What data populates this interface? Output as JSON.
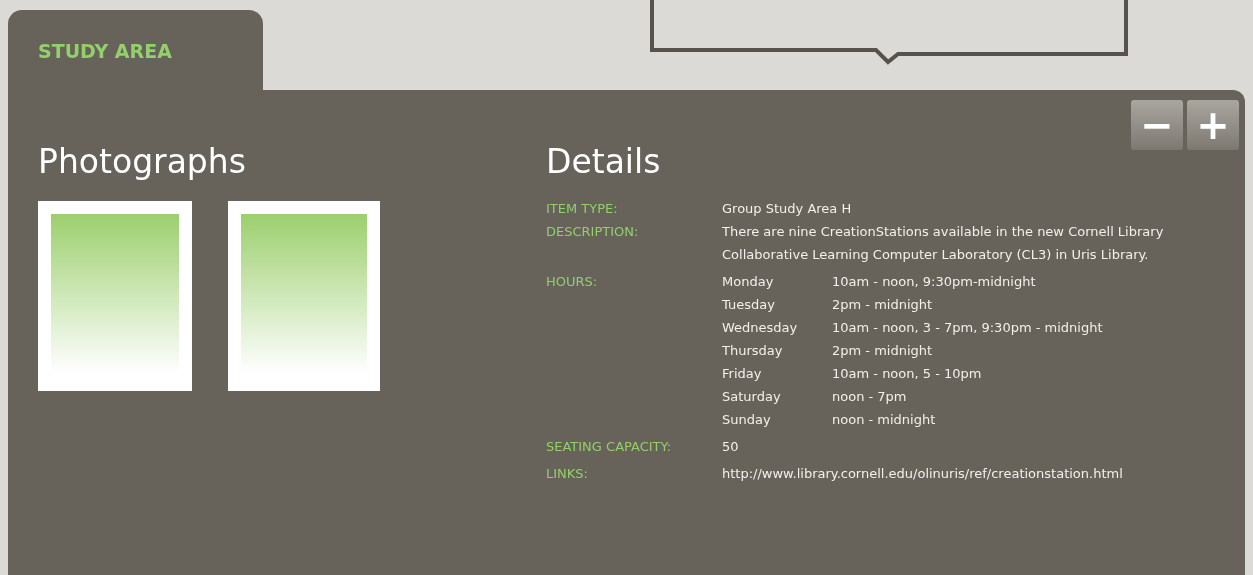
{
  "tab": {
    "label": "STUDY AREA",
    "selected": true
  },
  "zoom_buttons": [
    "−",
    "+"
  ],
  "photographs": {
    "title": "Photographs"
  },
  "details": {
    "title": "Details",
    "fields": [
      {
        "kind": "text",
        "label": "ITEM TYPE:",
        "value": "Group Study Area H"
      },
      {
        "kind": "text",
        "label": "DESCRIPTION:",
        "value": "There are nine CreationStations available in the new Cornell Library Collaborative Learning Computer Laboratory (CL3) in Uris Library."
      },
      {
        "kind": "hours",
        "label": "HOURS:",
        "rows": [
          {
            "day": "Monday",
            "time": "10am - noon, 9:30pm-midnight"
          },
          {
            "day": "Tuesday",
            "time": "2pm - midnight"
          },
          {
            "day": "Wednesday",
            "time": "10am - noon, 3 - 7pm, 9:30pm - midnight"
          },
          {
            "day": "Thursday",
            "time": "2pm - midnight"
          },
          {
            "day": "Friday",
            "time": "10am - noon, 5 - 10pm"
          },
          {
            "day": "Saturday",
            "time": "noon - 7pm"
          },
          {
            "day": "Sunday",
            "time": "noon - midnight"
          }
        ]
      },
      {
        "kind": "text",
        "label": "SEATING CAPACITY:",
        "value": "50"
      },
      {
        "kind": "link",
        "label": "LINKS:",
        "value": "http://www.library.cornell.edu/olinuris/ref/creationstation.html"
      }
    ]
  }
}
